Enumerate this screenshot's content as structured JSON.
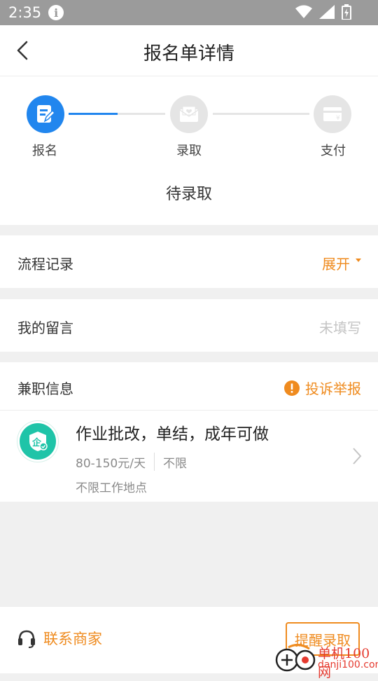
{
  "status_bar": {
    "time": "2:35",
    "info_glyph": "i"
  },
  "header": {
    "title": "报名单详情"
  },
  "steps": [
    {
      "label": "报名",
      "icon": "form-edit-icon",
      "active": true
    },
    {
      "label": "录取",
      "icon": "envelope-heart-icon",
      "active": false
    },
    {
      "label": "支付",
      "icon": "payment-card-icon",
      "active": false
    }
  ],
  "status_text": "待录取",
  "process": {
    "label": "流程记录",
    "toggle": "展开"
  },
  "message": {
    "label": "我的留言",
    "value": "未填写"
  },
  "job_section": {
    "label": "兼职信息",
    "report": "投诉举报"
  },
  "job": {
    "title": "作业批改，单结，成年可做",
    "salary": "80-150元/天",
    "requirement": "不限",
    "location": "不限工作地点",
    "logo_text": "企"
  },
  "bottom": {
    "contact": "联系商家",
    "remind": "提醒录取"
  },
  "watermark": {
    "brand": "单机100网",
    "url": "danji100.com"
  },
  "colors": {
    "accent": "#ef8b1f",
    "active_blue": "#2186ee",
    "logo_green": "#1fc4a8",
    "status_bar": "#9b9b9b"
  }
}
